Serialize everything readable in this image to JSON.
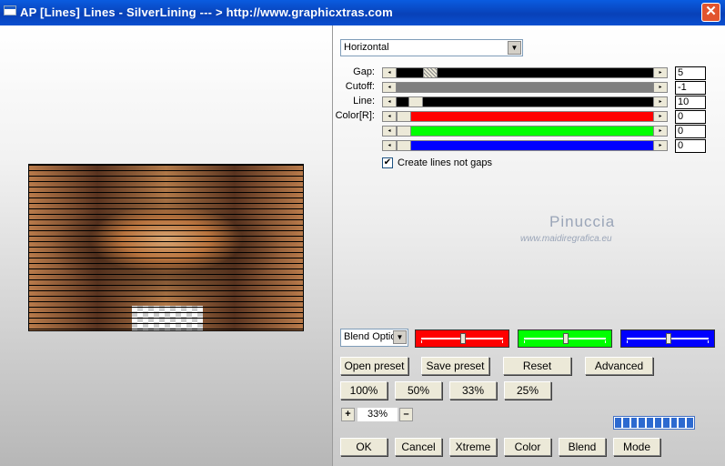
{
  "window": {
    "title": "AP [Lines]  Lines - SilverLining      --- > http://www.graphicxtras.com",
    "close_symbol": "✕"
  },
  "direction_select": {
    "value": "Horizontal"
  },
  "sliders": [
    {
      "label": "Gap:",
      "value": "5",
      "color": "#000000",
      "thumb_fraction": 0.11
    },
    {
      "label": "Cutoff:",
      "value": "-1",
      "color": "#7f7f7f",
      "thumb_fraction": null
    },
    {
      "label": "Line:",
      "value": "10",
      "color": "#000000",
      "thumb_fraction": 0.05
    },
    {
      "label": "Color[R]:",
      "value": "0",
      "color": "#ff0000",
      "thumb_fraction": 0.0
    },
    {
      "label": "",
      "value": "0",
      "color": "#00ff00",
      "thumb_fraction": 0.0
    },
    {
      "label": "",
      "value": "0",
      "color": "#0000ff",
      "thumb_fraction": 0.0
    }
  ],
  "checkbox": {
    "label": "Create lines not gaps",
    "checked": true,
    "mark": "✔"
  },
  "watermark": {
    "line1": "Pinuccia",
    "line2": "www.maidiregrafica.eu"
  },
  "blend_select": {
    "value": "Blend Optio"
  },
  "color_sliders": [
    {
      "color": "#ff0000",
      "level": 0.5
    },
    {
      "color": "#00ff00",
      "level": 0.5
    },
    {
      "color": "#0000ff",
      "level": 0.5
    }
  ],
  "buttons_row1": [
    "Open preset",
    "Save preset",
    "Reset",
    "Advanced"
  ],
  "zoom_buttons": [
    "100%",
    "50%",
    "33%",
    "25%"
  ],
  "zoom": {
    "plus": "+",
    "value": "33%",
    "minus": "–"
  },
  "progress_segments": 10,
  "bottom_buttons": [
    "OK",
    "Cancel",
    "Xtreme",
    "Color",
    "Blend",
    "Mode"
  ]
}
